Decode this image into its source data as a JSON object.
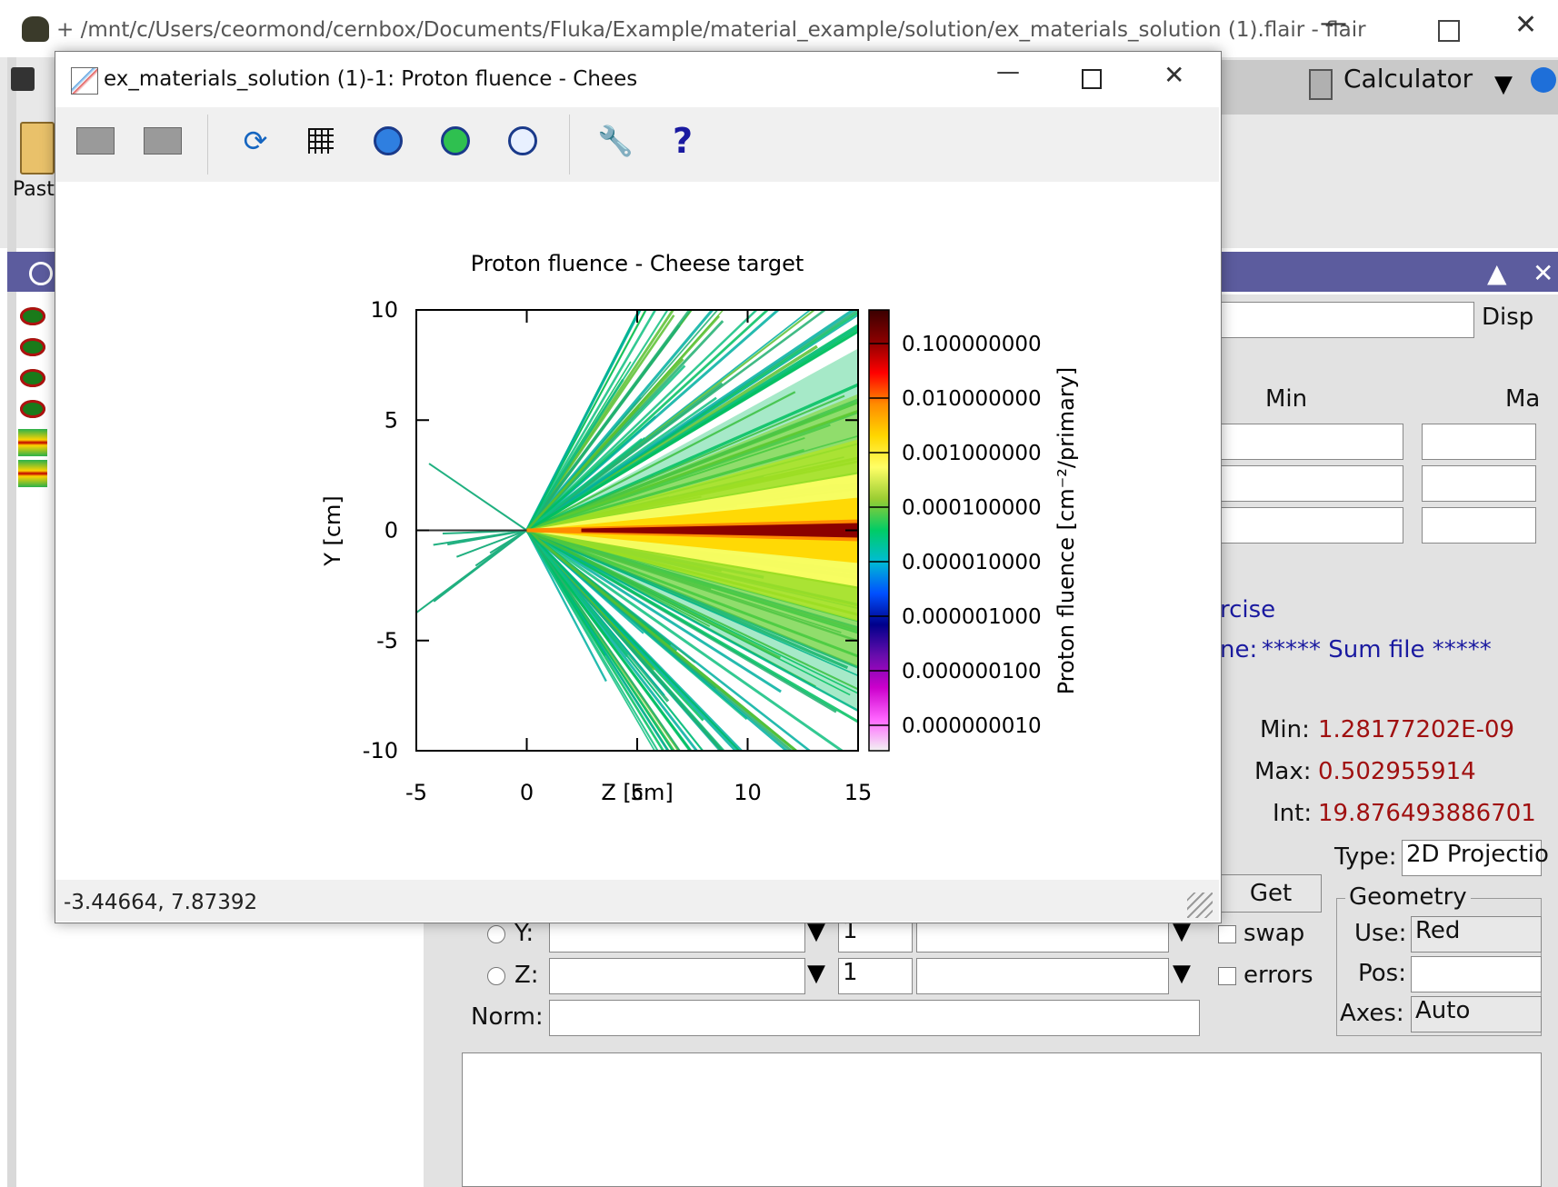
{
  "main_window": {
    "title": "+ /mnt/c/Users/ceormond/cernbox/Documents/Fluka/Example/material_example/solution/ex_materials_solution (1).flair - flair",
    "ribbon": {
      "paste_label": "Past",
      "calculator_label": "Calculator"
    },
    "panel": {
      "disp_label": "Disp",
      "min_header": "Min",
      "max_header": "Ma",
      "exercise_link": "rcise",
      "name_label": "ne:",
      "name_value": "***** Sum file *****",
      "stats": {
        "min_label": "Min:",
        "min_value": "1.28177202E-09",
        "max_label": "Max:",
        "max_value": "0.502955914",
        "int_label": "Int:",
        "int_value": "19.876493886701",
        "get_button": "Get"
      },
      "axis_rows": [
        {
          "label": "Y:",
          "step": "1"
        },
        {
          "label": "Z:",
          "step": "1"
        }
      ],
      "swap_label": "swap",
      "errors_label": "errors",
      "norm_label": "Norm:",
      "type_label": "Type:",
      "type_value": "2D Projectio",
      "geometry_group": "Geometry",
      "use_label": "Use:",
      "use_value": "Red",
      "pos_label": "Pos:",
      "axes_label": "Axes:",
      "axes_value": "Auto"
    }
  },
  "dialog": {
    "title": "ex_materials_solution (1)-1: Proton fluence - Chees",
    "toolbar_icons": [
      "window-icon",
      "window-icon",
      "refresh-icon",
      "grid-icon",
      "zoom-back-icon",
      "zoom-forward-icon",
      "zoom-fit-icon",
      "wrench-icon",
      "help-icon"
    ],
    "status_coords": "-3.44664,  7.87392"
  },
  "chart_data": {
    "type": "heatmap",
    "title": "Proton fluence - Cheese target",
    "xlabel": "Z [cm]",
    "ylabel": "Y [cm]",
    "xlim": [
      -5,
      15
    ],
    "ylim": [
      -10,
      10
    ],
    "xticks": [
      "-5",
      "0",
      "5",
      "10",
      "15"
    ],
    "yticks": [
      "10",
      "5",
      "0",
      "-5",
      "-10"
    ],
    "colorbar": {
      "label": "Proton fluence [cm⁻²/primary]",
      "scale": "log",
      "ticks": [
        "0.100000000",
        "0.010000000",
        "0.001000000",
        "0.000100000",
        "0.000010000",
        "0.000001000",
        "0.000000100",
        "0.000000010"
      ],
      "colors": [
        "#3a0000",
        "#8b0000",
        "#ff0000",
        "#ff8c00",
        "#ffd700",
        "#ffff66",
        "#9acd32",
        "#00cc66",
        "#00bcd4",
        "#0050ff",
        "#00008b",
        "#6a0dad",
        "#cc00cc",
        "#ff66ff",
        "#f2f2f2"
      ]
    },
    "beam": {
      "z_start": 0,
      "y": 0
    }
  }
}
